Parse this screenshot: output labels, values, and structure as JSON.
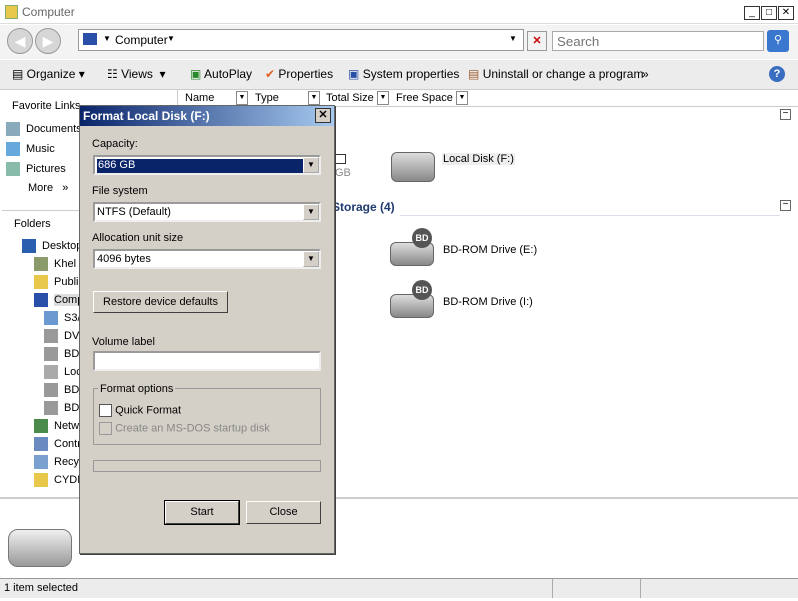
{
  "window": {
    "title": "Computer",
    "min": "_",
    "max": "□",
    "close": "✕"
  },
  "address": {
    "path": "Computer",
    "search_placeholder": "Search"
  },
  "toolbar": {
    "organize": "Organize",
    "views": "Views",
    "autoplay": "AutoPlay",
    "properties": "Properties",
    "system_properties": "System properties",
    "uninstall": "Uninstall or change a program",
    "more": "»"
  },
  "favorites": {
    "title": "Favorite Links",
    "items": [
      "Documents",
      "Music",
      "Pictures"
    ],
    "more": "More",
    "more_arrow": "»"
  },
  "folders": {
    "title": "Folders",
    "items": [
      "Desktop",
      "Khel",
      "Publi",
      "Comp",
      "S3/",
      "DVI",
      "BD-",
      "Loc",
      "BD-",
      "BD-",
      "Netw",
      "Contr",
      "Recy",
      "CYDE"
    ]
  },
  "columns": [
    "Name",
    "Type",
    "Total Size",
    "Free Space"
  ],
  "content": {
    "hdd_partial": "GB",
    "local_disk": "Local Disk (F:)",
    "removable_group": "Storage (4)",
    "drives": [
      "BD-ROM Drive (E:)",
      "BD-ROM Drive (I:)"
    ],
    "bd_badge": "BD"
  },
  "status": {
    "text": "1 item selected"
  },
  "dialog": {
    "title": "Format Local Disk (F:)",
    "close": "✕",
    "capacity_label": "Capacity:",
    "capacity": "686 GB",
    "fs_label": "File system",
    "fs": "NTFS (Default)",
    "alloc_label": "Allocation unit size",
    "alloc": "4096 bytes",
    "restore": "Restore device defaults",
    "volume_label": "Volume label",
    "volume_value": "",
    "options_title": "Format options",
    "quick": "Quick Format",
    "msdos": "Create an MS-DOS startup disk",
    "progress": 0,
    "start": "Start",
    "close_btn": "Close"
  }
}
